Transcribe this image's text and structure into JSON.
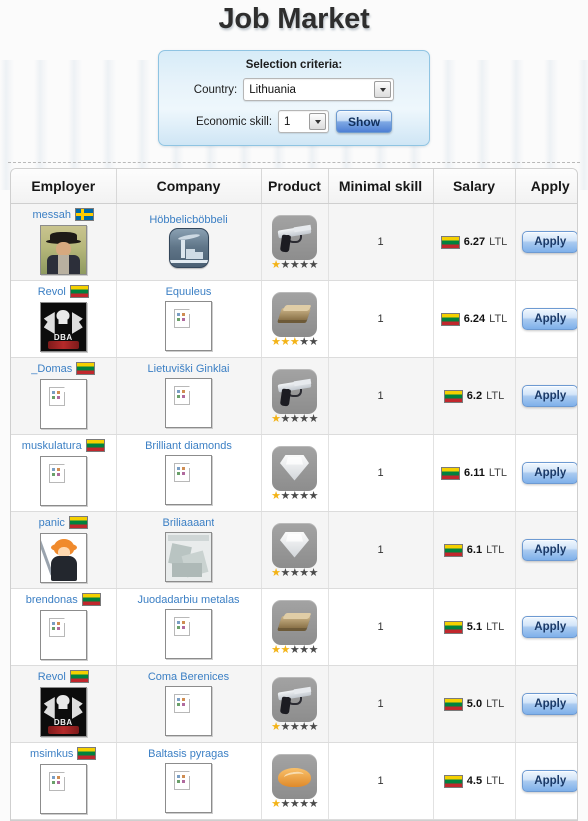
{
  "page": {
    "title": "Job Market"
  },
  "criteria": {
    "heading": "Selection criteria:",
    "country_label": "Country:",
    "country_value": "Lithuania",
    "skill_label": "Economic skill:",
    "skill_value": "1",
    "show_label": "Show"
  },
  "table": {
    "headers": [
      "Employer",
      "Company",
      "Product",
      "Minimal skill",
      "Salary",
      "Apply"
    ],
    "apply_label": "Apply",
    "currency": "LTL",
    "rows": [
      {
        "employer": "messah",
        "employer_flag": "se",
        "avatar": "cowboy",
        "company": "Höbbelicböbbeli",
        "company_icon": "factory",
        "product": "gun",
        "stars": 1,
        "skill": "1",
        "salary": "6.27",
        "salary_flag": "lt"
      },
      {
        "employer": "Revol",
        "employer_flag": "lt",
        "avatar": "band",
        "company": "Equuleus",
        "company_icon": "broken",
        "product": "gold",
        "stars": 3,
        "skill": "1",
        "salary": "6.24",
        "salary_flag": "lt"
      },
      {
        "employer": "_Domas",
        "employer_flag": "lt",
        "avatar": "broken",
        "company": "Lietuviški Ginklai",
        "company_icon": "broken",
        "product": "gun",
        "stars": 1,
        "skill": "1",
        "salary": "6.2",
        "salary_flag": "lt"
      },
      {
        "employer": "muskulatura",
        "employer_flag": "lt",
        "avatar": "broken",
        "company": "Brilliant diamonds",
        "company_icon": "broken",
        "product": "diamond",
        "stars": 1,
        "skill": "1",
        "salary": "6.11",
        "salary_flag": "lt"
      },
      {
        "employer": "panic",
        "employer_flag": "lt",
        "avatar": "panic",
        "company": "Briliaaaant",
        "company_icon": "map",
        "product": "diamond",
        "stars": 1,
        "skill": "1",
        "salary": "6.1",
        "salary_flag": "lt"
      },
      {
        "employer": "brendonas",
        "employer_flag": "lt",
        "avatar": "broken",
        "company": "Juodadarbiu metalas",
        "company_icon": "broken",
        "product": "gold",
        "stars": 2,
        "skill": "1",
        "salary": "5.1",
        "salary_flag": "lt"
      },
      {
        "employer": "Revol",
        "employer_flag": "lt",
        "avatar": "band",
        "company": "Coma Berenices",
        "company_icon": "broken",
        "product": "gun",
        "stars": 1,
        "skill": "1",
        "salary": "5.0",
        "salary_flag": "lt"
      },
      {
        "employer": "msimkus",
        "employer_flag": "lt",
        "avatar": "broken",
        "company": "Baltasis pyragas",
        "company_icon": "broken",
        "product": "bread",
        "stars": 1,
        "skill": "1",
        "salary": "4.5",
        "salary_flag": "lt"
      }
    ]
  },
  "colors": {
    "link": "#3b7fc4",
    "panel_border": "#8fc4e2",
    "star_on": "#f3b317",
    "star_off": "#4a4a4a"
  }
}
